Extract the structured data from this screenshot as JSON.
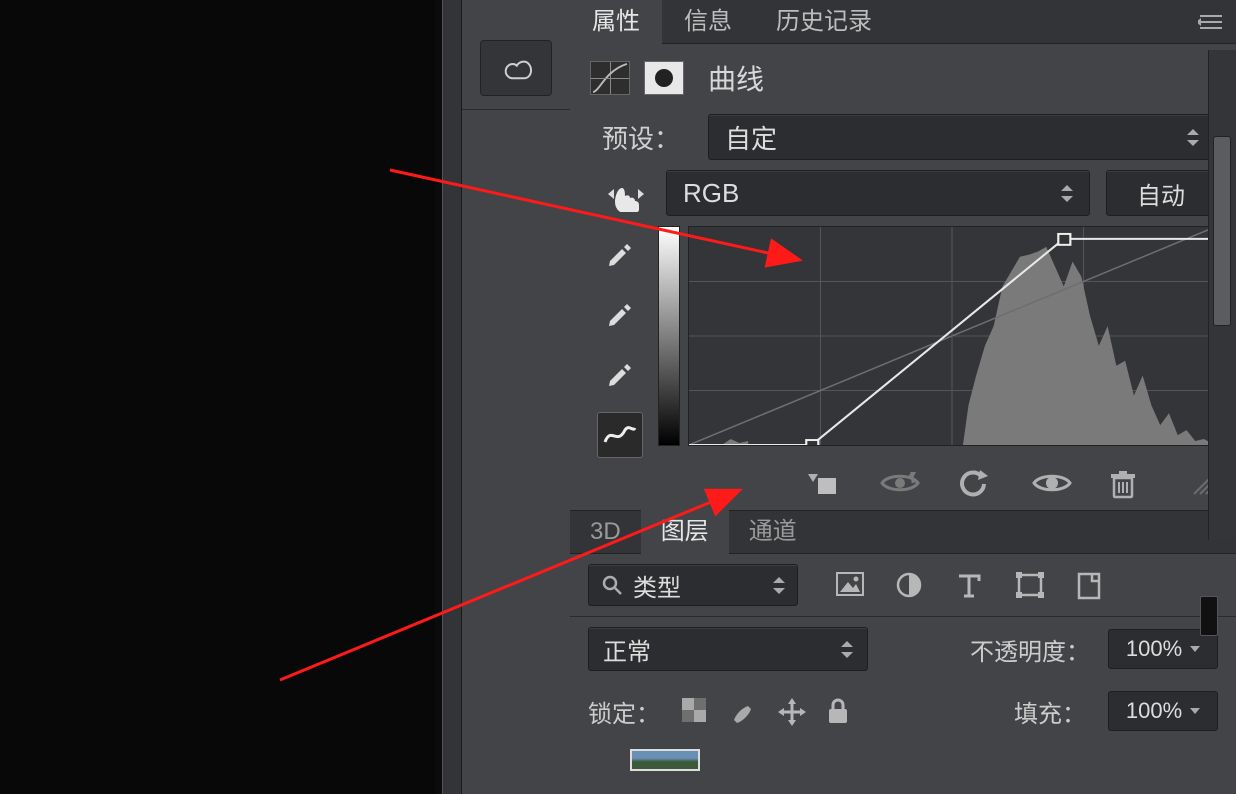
{
  "tabs": {
    "properties": "属性",
    "info": "信息",
    "history": "历史记录"
  },
  "adjustment": {
    "title": "曲线"
  },
  "preset": {
    "label": "预设：",
    "value": "自定"
  },
  "channel": {
    "value": "RGB"
  },
  "auto_btn": "自动",
  "curve_points": {
    "shadow": {
      "in": 60,
      "out": 0
    },
    "highlight": {
      "in": 182,
      "out": 247
    }
  },
  "layers_tabs": {
    "threeD": "3D",
    "layers": "图层",
    "channels": "通道"
  },
  "filter": {
    "label": "类型"
  },
  "blend": {
    "mode": "正常",
    "opacity_label": "不透明度：",
    "opacity": "100%"
  },
  "lock": {
    "label": "锁定：",
    "fill_label": "填充：",
    "fill": "100%"
  }
}
